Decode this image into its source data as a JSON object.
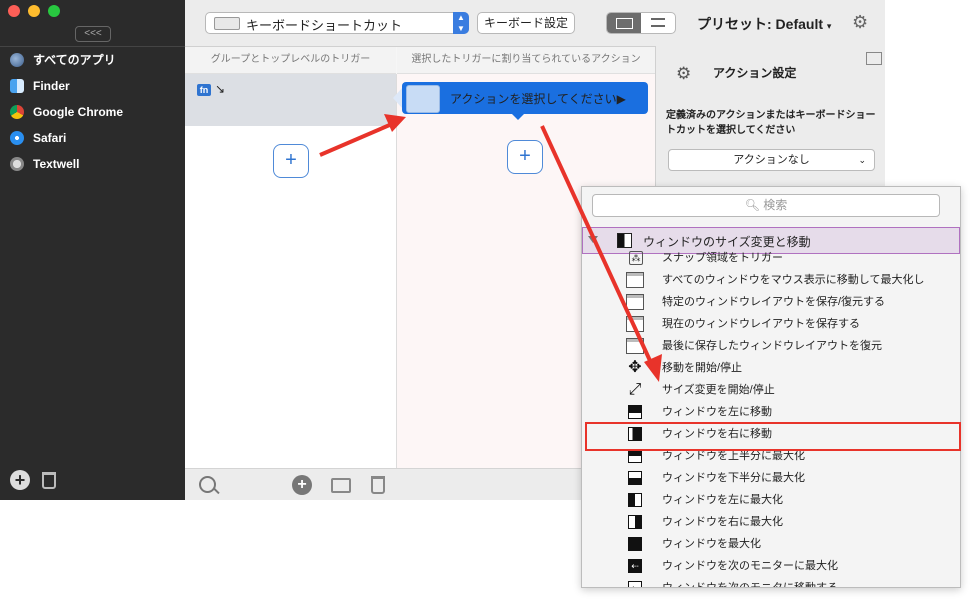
{
  "sidebar": {
    "collapse_label": "<<<",
    "apps": [
      {
        "label": "すべてのアプリ",
        "icon": "globe-icon",
        "selected": true
      },
      {
        "label": "Finder",
        "icon": "finder-icon"
      },
      {
        "label": "Google Chrome",
        "icon": "chrome-icon"
      },
      {
        "label": "Safari",
        "icon": "safari-icon"
      },
      {
        "label": "Textwell",
        "icon": "textwell-icon"
      }
    ]
  },
  "toolbar": {
    "app_select": "キーボードショートカット",
    "keyboard_settings": "キーボード設定",
    "preset": "プリセット: Default"
  },
  "columns": {
    "trigger_header": "グループとトップレベルのトリガー",
    "action_header": "選択したトリガーに割り当てられているアクション"
  },
  "trigger": {
    "fn_label": "fn",
    "arrow": "↘"
  },
  "action": {
    "pill_text": "アクションを選択してください▶"
  },
  "settings": {
    "title": "アクション設定",
    "description": "定義済みのアクションまたはキーボードショートカットを選択してください",
    "select_value": "アクションなし"
  },
  "dropdown": {
    "search_placeholder": "検索",
    "group_label": "ウィンドウのサイズ変更と移動",
    "items": [
      {
        "label": "スナップ領域をトリガー",
        "icon": "snap-area-icon"
      },
      {
        "label": "すべてのウィンドウをマウス表示に移動して最大化し",
        "icon": "window-icon"
      },
      {
        "label": "特定のウィンドウレイアウトを保存/復元する",
        "icon": "window-icon"
      },
      {
        "label": "現在のウィンドウレイアウトを保存する",
        "icon": "window-icon"
      },
      {
        "label": "最後に保存したウィンドウレイアウトを復元",
        "icon": "window-icon"
      },
      {
        "label": "移動を開始/停止",
        "icon": "move-arrows-icon"
      },
      {
        "label": "サイズ変更を開始/停止",
        "icon": "resize-arrows-icon"
      },
      {
        "label": "ウィンドウを左に移動",
        "icon": "move-left-icon"
      },
      {
        "label": "ウィンドウを右に移動",
        "icon": "move-right-icon",
        "highlighted": true
      },
      {
        "label": "ウィンドウを上半分に最大化",
        "icon": "top-half-icon"
      },
      {
        "label": "ウィンドウを下半分に最大化",
        "icon": "bottom-half-icon"
      },
      {
        "label": "ウィンドウを左に最大化",
        "icon": "left-half-icon"
      },
      {
        "label": "ウィンドウを右に最大化",
        "icon": "right-half-icon"
      },
      {
        "label": "ウィンドウを最大化",
        "icon": "maximize-icon"
      },
      {
        "label": "ウィンドウを次のモニターに最大化",
        "icon": "next-monitor-icon"
      },
      {
        "label": "ウィンドウを次のモニタに移動する",
        "icon": "next-monitor-move-icon"
      }
    ]
  },
  "colors": {
    "accent": "#1a6fe0",
    "sidebar_bg": "#2b2b2b",
    "annotation_red": "#e8332a",
    "group_highlight": "#b071c0"
  }
}
